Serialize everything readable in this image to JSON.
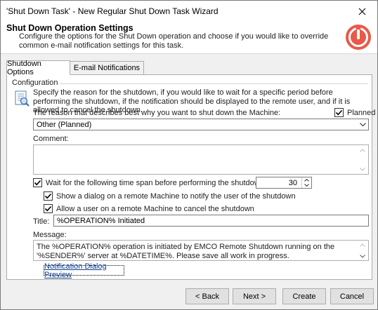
{
  "window": {
    "title": "'Shut Down Task' - New Regular Shut Down Task Wizard"
  },
  "header": {
    "title": "Shut Down Operation Settings",
    "description": "Configure the options for the Shut Down operation and choose if you would like to override common e-mail notification settings for this task."
  },
  "tabs": [
    {
      "label": "Shutdown Options",
      "active": true
    },
    {
      "label": "E-mail Notifications",
      "active": false
    }
  ],
  "configuration": {
    "section_label": "Configuration",
    "description": "Specify the reason for the shutdown, if you would like to wait for a specific period before performing the shutdown, if the notification should be displayed to the remote user, and if it is allowed to cancel the shutdown.",
    "reason_label": "The reason that describes best why you want to shut down the Machine:",
    "planned_label": "Planned",
    "planned_checked": true,
    "reason_value": "Other (Planned)",
    "comment_label": "Comment:",
    "comment_value": "",
    "wait_label": "Wait for the following time span before performing the shutdown (sec):",
    "wait_checked": true,
    "wait_value": "30",
    "show_dialog_label": "Show a dialog on a remote Machine to notify the user of the shutdown",
    "show_dialog_checked": true,
    "allow_cancel_label": "Allow a user on a remote Machine to cancel the shutdown",
    "allow_cancel_checked": true,
    "title_label": "Title:",
    "title_value": "%OPERATION% Initiated",
    "message_label": "Message:",
    "message_value": "The %OPERATION% operation is initiated by EMCO Remote Shutdown running on the '%SENDER%' server at %DATETIME%. Please save all work in progress.",
    "preview_link": "Notification Dialog Preview"
  },
  "footer": {
    "back": "< Back",
    "next": "Next >",
    "create": "Create",
    "cancel": "Cancel"
  },
  "colors": {
    "header_icon": "#e8594a",
    "link": "#0b3c8f"
  }
}
